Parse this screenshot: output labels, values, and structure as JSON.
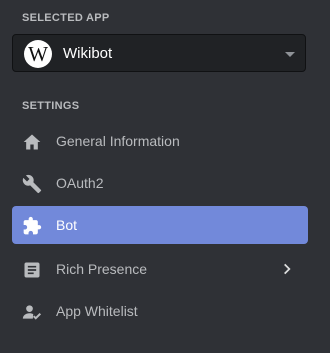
{
  "selected_app": {
    "section_title": "SELECTED APP",
    "app_name": "Wikibot",
    "logo_letter": "W",
    "dropdown_icon": "caret-down-icon"
  },
  "settings": {
    "section_title": "SETTINGS",
    "items": [
      {
        "label": "General Information",
        "icon": "home-icon",
        "active": false
      },
      {
        "label": "OAuth2",
        "icon": "wrench-icon",
        "active": false
      },
      {
        "label": "Bot",
        "icon": "puzzle-piece-icon",
        "active": true
      },
      {
        "label": "Rich Presence",
        "icon": "document-icon",
        "active": false,
        "has_submenu": true
      },
      {
        "label": "App Whitelist",
        "icon": "user-check-icon",
        "active": false
      }
    ]
  },
  "colors": {
    "background": "#2f3136",
    "select_background": "#202225",
    "active_item": "#7289da",
    "text_muted": "#b9bbbe",
    "text_active": "#ffffff"
  }
}
